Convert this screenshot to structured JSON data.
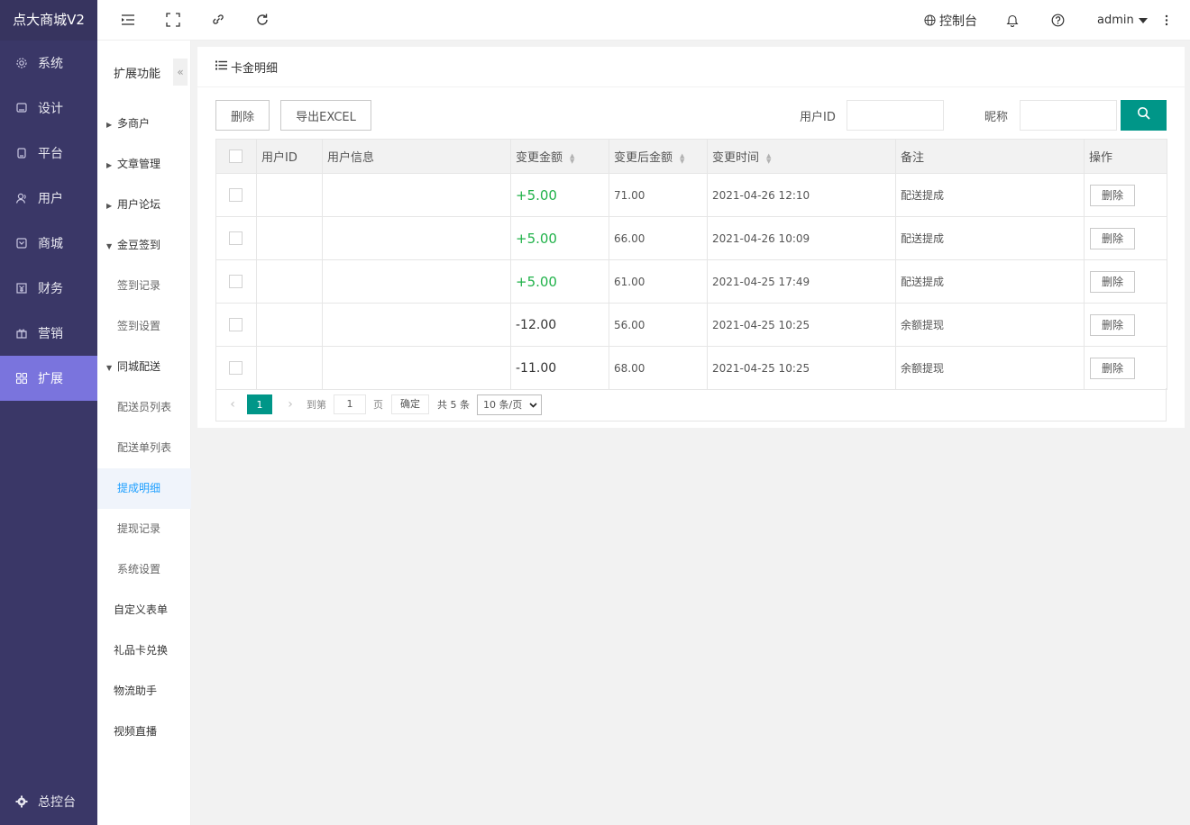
{
  "brand": "点大商城V2",
  "nav": [
    {
      "label": "系统",
      "icon": "gear-icon"
    },
    {
      "label": "设计",
      "icon": "monitor-icon"
    },
    {
      "label": "平台",
      "icon": "device-icon"
    },
    {
      "label": "用户",
      "icon": "user-icon"
    },
    {
      "label": "商城",
      "icon": "store-icon"
    },
    {
      "label": "财务",
      "icon": "finance-icon"
    },
    {
      "label": "营销",
      "icon": "gift-icon"
    },
    {
      "label": "扩展",
      "icon": "grid-icon"
    }
  ],
  "nav_active": "扩展",
  "nav_bottom": "总控台",
  "header": {
    "console": "控制台",
    "user": "admin"
  },
  "sub": {
    "title": "扩展功能",
    "collapse": "«",
    "items": [
      {
        "label": "多商户"
      },
      {
        "label": "文章管理"
      },
      {
        "label": "用户论坛"
      },
      {
        "label": "金豆签到"
      },
      {
        "label": "签到记录"
      },
      {
        "label": "签到设置"
      },
      {
        "label": "同城配送"
      },
      {
        "label": "配送员列表"
      },
      {
        "label": "配送单列表"
      },
      {
        "label": "提成明细"
      },
      {
        "label": "提现记录"
      },
      {
        "label": "系统设置"
      },
      {
        "label": "自定义表单"
      },
      {
        "label": "礼品卡兑换"
      },
      {
        "label": "物流助手"
      },
      {
        "label": "视频直播"
      }
    ]
  },
  "panel": {
    "title": "卡金明细",
    "delete_btn": "删除",
    "export_btn": "导出EXCEL",
    "uid_label": "用户ID",
    "uid_value": "",
    "nick_label": "昵称",
    "nick_value": ""
  },
  "table": {
    "headers": [
      "用户ID",
      "用户信息",
      "变更金额",
      "变更后金额",
      "变更时间",
      "备注",
      "操作"
    ],
    "rows": [
      {
        "uid": "",
        "info": "",
        "amount": "+5.00",
        "after": "71.00",
        "time": "2021-04-26 12:10",
        "remark": "配送提成",
        "action": "删除"
      },
      {
        "uid": "",
        "info": "",
        "amount": "+5.00",
        "after": "66.00",
        "time": "2021-04-26 10:09",
        "remark": "配送提成",
        "action": "删除"
      },
      {
        "uid": "",
        "info": "",
        "amount": "+5.00",
        "after": "61.00",
        "time": "2021-04-25 17:49",
        "remark": "配送提成",
        "action": "删除"
      },
      {
        "uid": "",
        "info": "",
        "amount": "-12.00",
        "after": "56.00",
        "time": "2021-04-25 10:25",
        "remark": "余额提现",
        "action": "删除"
      },
      {
        "uid": "",
        "info": "",
        "amount": "-11.00",
        "after": "68.00",
        "time": "2021-04-25 10:25",
        "remark": "余额提现",
        "action": "删除"
      }
    ]
  },
  "pager": {
    "current": "1",
    "goto": "到第",
    "page_input": "1",
    "page_unit": "页",
    "confirm": "确定",
    "total": "共 5 条",
    "per_page": "10 条/页"
  },
  "colors": {
    "sidebar": "#3a3767",
    "active": "#7a74dd",
    "primary": "#009688",
    "positive": "#21b24a"
  }
}
